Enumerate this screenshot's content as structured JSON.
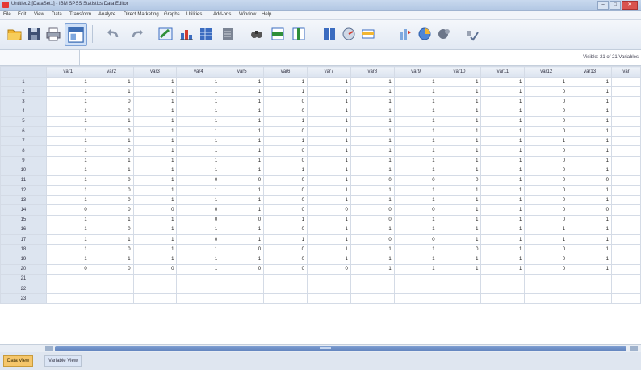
{
  "window": {
    "title": "Untitled2 [DataSet1] - IBM SPSS Statistics Data Editor",
    "buttons": [
      "–",
      "□",
      "✕"
    ]
  },
  "menu": [
    "File",
    "Edit",
    "View",
    "Data",
    "Transform",
    "Analyze",
    "Direct Marketing",
    "Graphs",
    "Utilities",
    "Add-ons",
    "Window",
    "Help"
  ],
  "toolbar": {
    "icons": [
      "open-icon",
      "save-icon",
      "print-icon",
      "dialog-recall-icon",
      "undo-icon",
      "redo-icon",
      "goto-case-icon",
      "goto-variable-icon",
      "variables-icon",
      "run-descriptives-icon",
      "find-icon",
      "insert-cases-icon",
      "insert-variable-icon",
      "split-file-icon",
      "weight-cases-icon",
      "select-cases-icon",
      "value-labels-icon",
      "use-sets-icon",
      "show-all-variables-icon",
      "spelling-icon"
    ]
  },
  "cellbar": {
    "visible_info": "Visible: 21 of 21 Variables"
  },
  "columns": [
    "var1",
    "var2",
    "var3",
    "var4",
    "var5",
    "var6",
    "var7",
    "var8",
    "var9",
    "var10",
    "var11",
    "var12",
    "var13",
    "var"
  ],
  "rows": [
    {
      "n": "1",
      "cells": [
        "1",
        "1",
        "1",
        "1",
        "1",
        "1",
        "1",
        "1",
        "1",
        "1",
        "1",
        "1",
        "1",
        ""
      ]
    },
    {
      "n": "2",
      "cells": [
        "1",
        "1",
        "1",
        "1",
        "1",
        "1",
        "1",
        "1",
        "1",
        "1",
        "1",
        "0",
        "1",
        ""
      ]
    },
    {
      "n": "3",
      "cells": [
        "1",
        "0",
        "1",
        "1",
        "1",
        "0",
        "1",
        "1",
        "1",
        "1",
        "1",
        "0",
        "1",
        ""
      ]
    },
    {
      "n": "4",
      "cells": [
        "1",
        "0",
        "1",
        "1",
        "1",
        "0",
        "1",
        "1",
        "1",
        "1",
        "1",
        "0",
        "1",
        ""
      ]
    },
    {
      "n": "5",
      "cells": [
        "1",
        "1",
        "1",
        "1",
        "1",
        "1",
        "1",
        "1",
        "1",
        "1",
        "1",
        "0",
        "1",
        ""
      ]
    },
    {
      "n": "6",
      "cells": [
        "1",
        "0",
        "1",
        "1",
        "1",
        "0",
        "1",
        "1",
        "1",
        "1",
        "1",
        "0",
        "1",
        ""
      ]
    },
    {
      "n": "7",
      "cells": [
        "1",
        "1",
        "1",
        "1",
        "1",
        "1",
        "1",
        "1",
        "1",
        "1",
        "1",
        "1",
        "1",
        ""
      ]
    },
    {
      "n": "8",
      "cells": [
        "1",
        "0",
        "1",
        "1",
        "1",
        "0",
        "1",
        "1",
        "1",
        "1",
        "1",
        "0",
        "1",
        ""
      ]
    },
    {
      "n": "9",
      "cells": [
        "1",
        "1",
        "1",
        "1",
        "1",
        "0",
        "1",
        "1",
        "1",
        "1",
        "1",
        "0",
        "1",
        ""
      ]
    },
    {
      "n": "10",
      "cells": [
        "1",
        "1",
        "1",
        "1",
        "1",
        "1",
        "1",
        "1",
        "1",
        "1",
        "1",
        "0",
        "1",
        ""
      ]
    },
    {
      "n": "11",
      "cells": [
        "1",
        "0",
        "1",
        "0",
        "0",
        "0",
        "1",
        "0",
        "0",
        "0",
        "1",
        "0",
        "0",
        ""
      ]
    },
    {
      "n": "12",
      "cells": [
        "1",
        "0",
        "1",
        "1",
        "1",
        "0",
        "1",
        "1",
        "1",
        "1",
        "1",
        "0",
        "1",
        ""
      ]
    },
    {
      "n": "13",
      "cells": [
        "1",
        "0",
        "1",
        "1",
        "1",
        "0",
        "1",
        "1",
        "1",
        "1",
        "1",
        "0",
        "1",
        ""
      ]
    },
    {
      "n": "14",
      "cells": [
        "0",
        "0",
        "0",
        "0",
        "1",
        "0",
        "0",
        "0",
        "0",
        "1",
        "1",
        "0",
        "0",
        ""
      ]
    },
    {
      "n": "15",
      "cells": [
        "1",
        "1",
        "1",
        "0",
        "0",
        "1",
        "1",
        "0",
        "1",
        "1",
        "1",
        "0",
        "1",
        ""
      ]
    },
    {
      "n": "16",
      "cells": [
        "1",
        "0",
        "1",
        "1",
        "1",
        "0",
        "1",
        "1",
        "1",
        "1",
        "1",
        "1",
        "1",
        ""
      ]
    },
    {
      "n": "17",
      "cells": [
        "1",
        "1",
        "1",
        "0",
        "1",
        "1",
        "1",
        "0",
        "0",
        "1",
        "1",
        "1",
        "1",
        ""
      ]
    },
    {
      "n": "18",
      "cells": [
        "1",
        "0",
        "1",
        "1",
        "0",
        "0",
        "1",
        "1",
        "1",
        "0",
        "1",
        "0",
        "1",
        ""
      ]
    },
    {
      "n": "19",
      "cells": [
        "1",
        "1",
        "1",
        "1",
        "1",
        "0",
        "1",
        "1",
        "1",
        "1",
        "1",
        "0",
        "1",
        ""
      ]
    },
    {
      "n": "20",
      "cells": [
        "0",
        "0",
        "0",
        "1",
        "0",
        "0",
        "0",
        "1",
        "1",
        "1",
        "1",
        "0",
        "1",
        ""
      ]
    },
    {
      "n": "21",
      "cells": [
        "",
        "",
        "",
        "",
        "",
        "",
        "",
        "",
        "",
        "",
        "",
        "",
        "",
        ""
      ]
    },
    {
      "n": "22",
      "cells": [
        "",
        "",
        "",
        "",
        "",
        "",
        "",
        "",
        "",
        "",
        "",
        "",
        "",
        ""
      ]
    },
    {
      "n": "23",
      "cells": [
        "",
        "",
        "",
        "",
        "",
        "",
        "",
        "",
        "",
        "",
        "",
        "",
        "",
        ""
      ]
    }
  ],
  "tabs": {
    "data_view": "Data View",
    "variable_view": "Variable View"
  }
}
